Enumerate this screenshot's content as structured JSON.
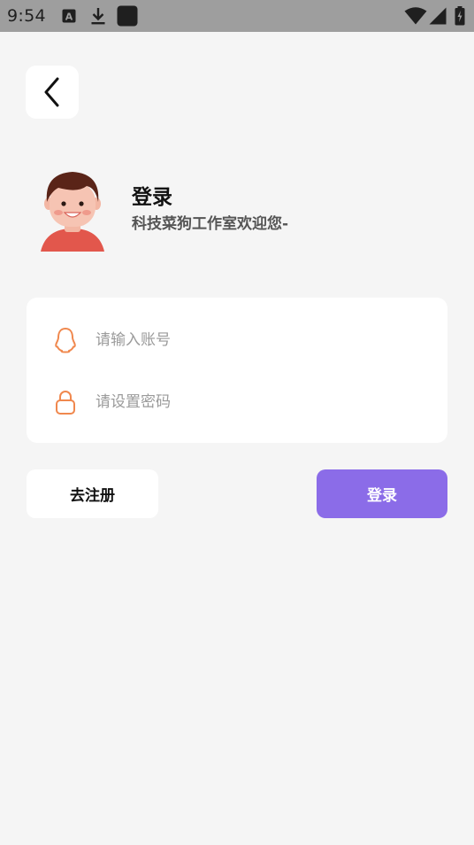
{
  "status_bar": {
    "time": "9:54",
    "icons": [
      "keyboard-a-icon",
      "download-icon",
      "app-square-icon",
      "wifi-icon",
      "signal-icon",
      "battery-charging-icon"
    ]
  },
  "nav": {
    "back_icon": "chevron-left-icon"
  },
  "header": {
    "title": "登录",
    "subtitle": "科技菜狗工作室欢迎您-"
  },
  "form": {
    "account": {
      "icon": "qq-penguin-icon",
      "placeholder": "请输入账号",
      "value": ""
    },
    "password": {
      "icon": "lock-icon",
      "placeholder": "请设置密码",
      "value": ""
    }
  },
  "actions": {
    "register_label": "去注册",
    "login_label": "登录"
  },
  "colors": {
    "accent": "#8b6ce8",
    "icon_orange": "#f0884e",
    "status_bar": "#9e9e9e",
    "background": "#f5f5f5"
  }
}
